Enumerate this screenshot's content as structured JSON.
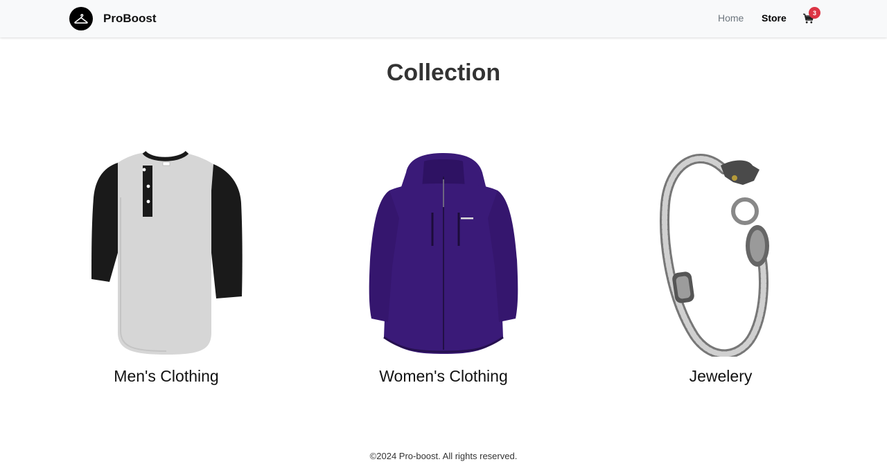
{
  "nav": {
    "brand": "ProBoost",
    "links": [
      {
        "label": "Home"
      },
      {
        "label": "Store"
      }
    ],
    "cart_count": "3"
  },
  "main": {
    "title": "Collection",
    "categories": [
      {
        "label": "Men's Clothing",
        "image": "raglan-henley-shirt"
      },
      {
        "label": "Women's Clothing",
        "image": "purple-jacket"
      },
      {
        "label": "Jewelery",
        "image": "dragon-bracelet"
      }
    ]
  },
  "footer": {
    "text": "©2024 Pro-boost. All rights reserved."
  },
  "colors": {
    "navbar_bg": "#f8f9fa",
    "badge": "#dc3545",
    "jacket": "#3a1a78"
  }
}
